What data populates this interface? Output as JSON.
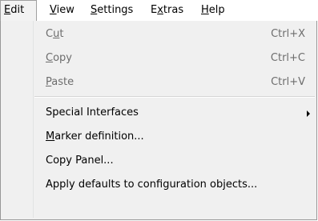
{
  "menubar": {
    "items": [
      {
        "label": "Edit",
        "underline": "E"
      },
      {
        "label": "View",
        "underline": "V"
      },
      {
        "label": "Settings",
        "underline": "S"
      },
      {
        "label": "Extras",
        "underline": "x"
      },
      {
        "label": "Help",
        "underline": "H"
      }
    ]
  },
  "edit_menu": {
    "items": [
      {
        "label": "Cut",
        "shortcut": "Ctrl+X",
        "enabled": false
      },
      {
        "label": "Copy",
        "shortcut": "Ctrl+C",
        "enabled": false
      },
      {
        "label": "Paste",
        "shortcut": "Ctrl+V",
        "enabled": false
      },
      {
        "label": "Special Interfaces",
        "submenu": true,
        "enabled": true
      },
      {
        "label": "Marker definition...",
        "enabled": true
      },
      {
        "label": "Copy Panel...",
        "enabled": true
      },
      {
        "label": "Apply defaults to configuration objects...",
        "enabled": true
      }
    ]
  }
}
